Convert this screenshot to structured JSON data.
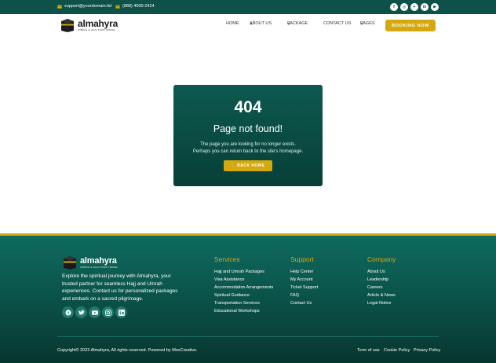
{
  "topbar": {
    "email": "support@yourdomain.ltd",
    "phone": "(888) 4000-2424",
    "socials": [
      "facebook-icon",
      "instagram-icon",
      "twitter-icon",
      "linkedin-icon",
      "youtube-icon"
    ]
  },
  "brand": {
    "name": "almahyra",
    "tagline": "UMROH & HAJJ TOUR TRAVEL"
  },
  "nav": {
    "home": "HOME",
    "about": "ABOUT US",
    "package": "PACKAGE",
    "contact": "CONTACT US",
    "pages": "PAGES",
    "cta": "BOOKING NOW"
  },
  "error": {
    "code": "404",
    "title": "Page not found!",
    "line1": "The page you are looking for no longer exists.",
    "line2": "Perhaps you can return back to the site's homepage.",
    "button": "BACK HOME"
  },
  "footer": {
    "description": "Explore the spiritual journey with Almahyra, your trusted partner for seamless Hajj and Umrah experiences. Contact us for personalized packages and embark on a sacred pilgrimage.",
    "services": {
      "heading": "Services",
      "items": [
        "Hajj and Umrah Packages",
        "Visa Assistance",
        "Accommodation Arrangements",
        "Spiritual Guidance",
        "Transportation Services",
        "Educational Workshops"
      ]
    },
    "support": {
      "heading": "Support",
      "items": [
        "Help Center",
        "My Account",
        "Ticket Support",
        "FAQ",
        "Contact Us"
      ]
    },
    "company": {
      "heading": "Company",
      "items": [
        "About Us",
        "Leadership",
        "Careers",
        "Article & News",
        "Legal Notice"
      ]
    },
    "copyright": "Copyright© 2023 Almahyra, All rights reserved. Powered by MoxCreative.",
    "terms": "Term of use",
    "cookie": "Cookie Policy",
    "privacy": "Privacy Policy"
  },
  "colors": {
    "primary": "#0d5148",
    "accent": "#d4a80f"
  }
}
